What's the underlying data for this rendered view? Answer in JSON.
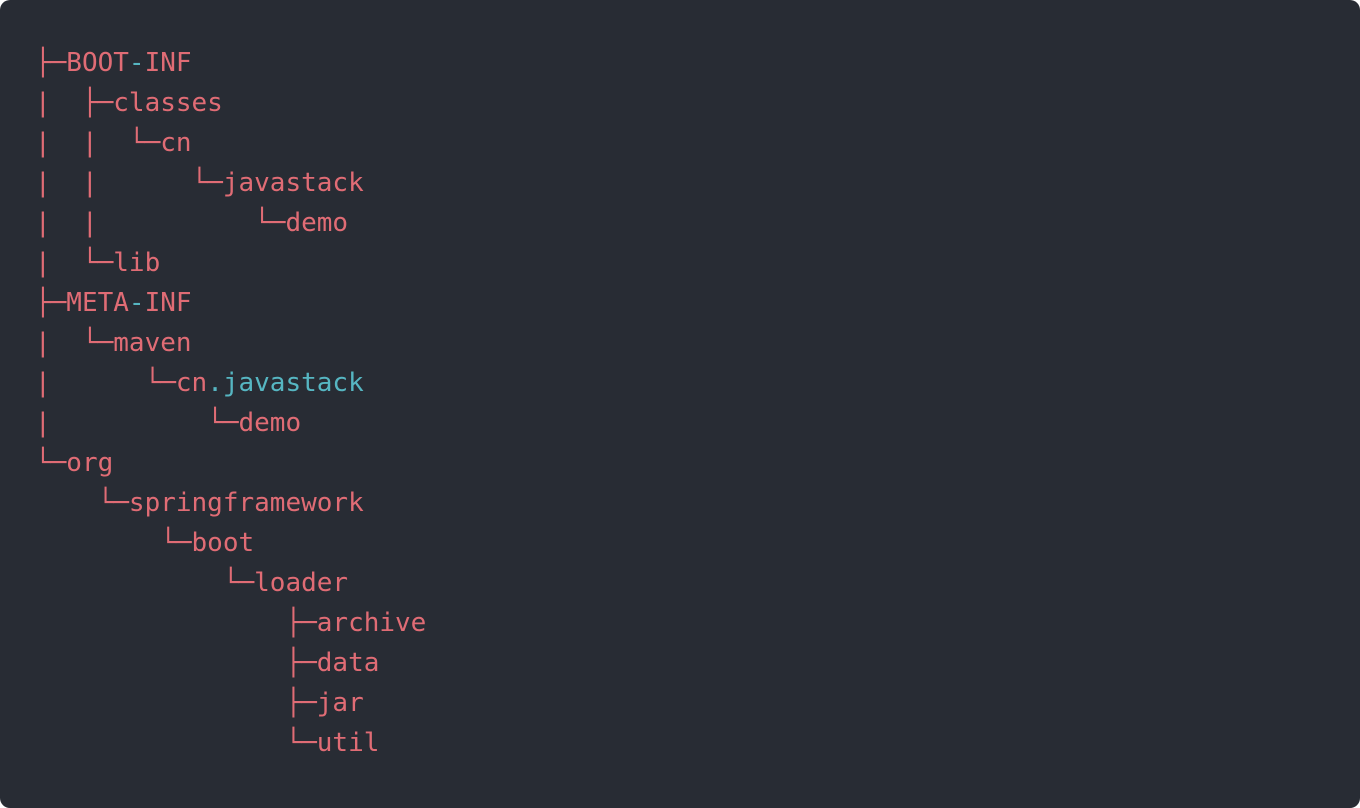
{
  "colors": {
    "background": "#282c34",
    "text": "#e06c75",
    "accent": "#56b6c2"
  },
  "tree": [
    {
      "name": "tree-line-boot-inf",
      "parts": [
        {
          "text": "├─BOOT"
        },
        {
          "text": "-",
          "accent": true
        },
        {
          "text": "INF"
        }
      ]
    },
    {
      "name": "tree-line-classes",
      "parts": [
        {
          "text": "|  ├─classes"
        }
      ]
    },
    {
      "name": "tree-line-cn",
      "parts": [
        {
          "text": "|  |  └─cn"
        }
      ]
    },
    {
      "name": "tree-line-javastack",
      "parts": [
        {
          "text": "|  |      └─javastack"
        }
      ]
    },
    {
      "name": "tree-line-demo",
      "parts": [
        {
          "text": "|  |          └─demo"
        }
      ]
    },
    {
      "name": "tree-line-lib",
      "parts": [
        {
          "text": "|  └─lib"
        }
      ]
    },
    {
      "name": "tree-line-meta-inf",
      "parts": [
        {
          "text": "├─META"
        },
        {
          "text": "-",
          "accent": true
        },
        {
          "text": "INF"
        }
      ]
    },
    {
      "name": "tree-line-maven",
      "parts": [
        {
          "text": "|  └─maven"
        }
      ]
    },
    {
      "name": "tree-line-cn-javastack",
      "parts": [
        {
          "text": "|      └─cn"
        },
        {
          "text": ".javastack",
          "accent": true
        }
      ]
    },
    {
      "name": "tree-line-maven-demo",
      "parts": [
        {
          "text": "|          └─demo"
        }
      ]
    },
    {
      "name": "tree-line-org",
      "parts": [
        {
          "text": "└─org"
        }
      ]
    },
    {
      "name": "tree-line-springframework",
      "parts": [
        {
          "text": "    └─springframework"
        }
      ]
    },
    {
      "name": "tree-line-boot",
      "parts": [
        {
          "text": "        └─boot"
        }
      ]
    },
    {
      "name": "tree-line-loader",
      "parts": [
        {
          "text": "            └─loader"
        }
      ]
    },
    {
      "name": "tree-line-archive",
      "parts": [
        {
          "text": "                ├─archive"
        }
      ]
    },
    {
      "name": "tree-line-data",
      "parts": [
        {
          "text": "                ├─data"
        }
      ]
    },
    {
      "name": "tree-line-jar",
      "parts": [
        {
          "text": "                ├─jar"
        }
      ]
    },
    {
      "name": "tree-line-util",
      "parts": [
        {
          "text": "                └─util"
        }
      ]
    }
  ]
}
